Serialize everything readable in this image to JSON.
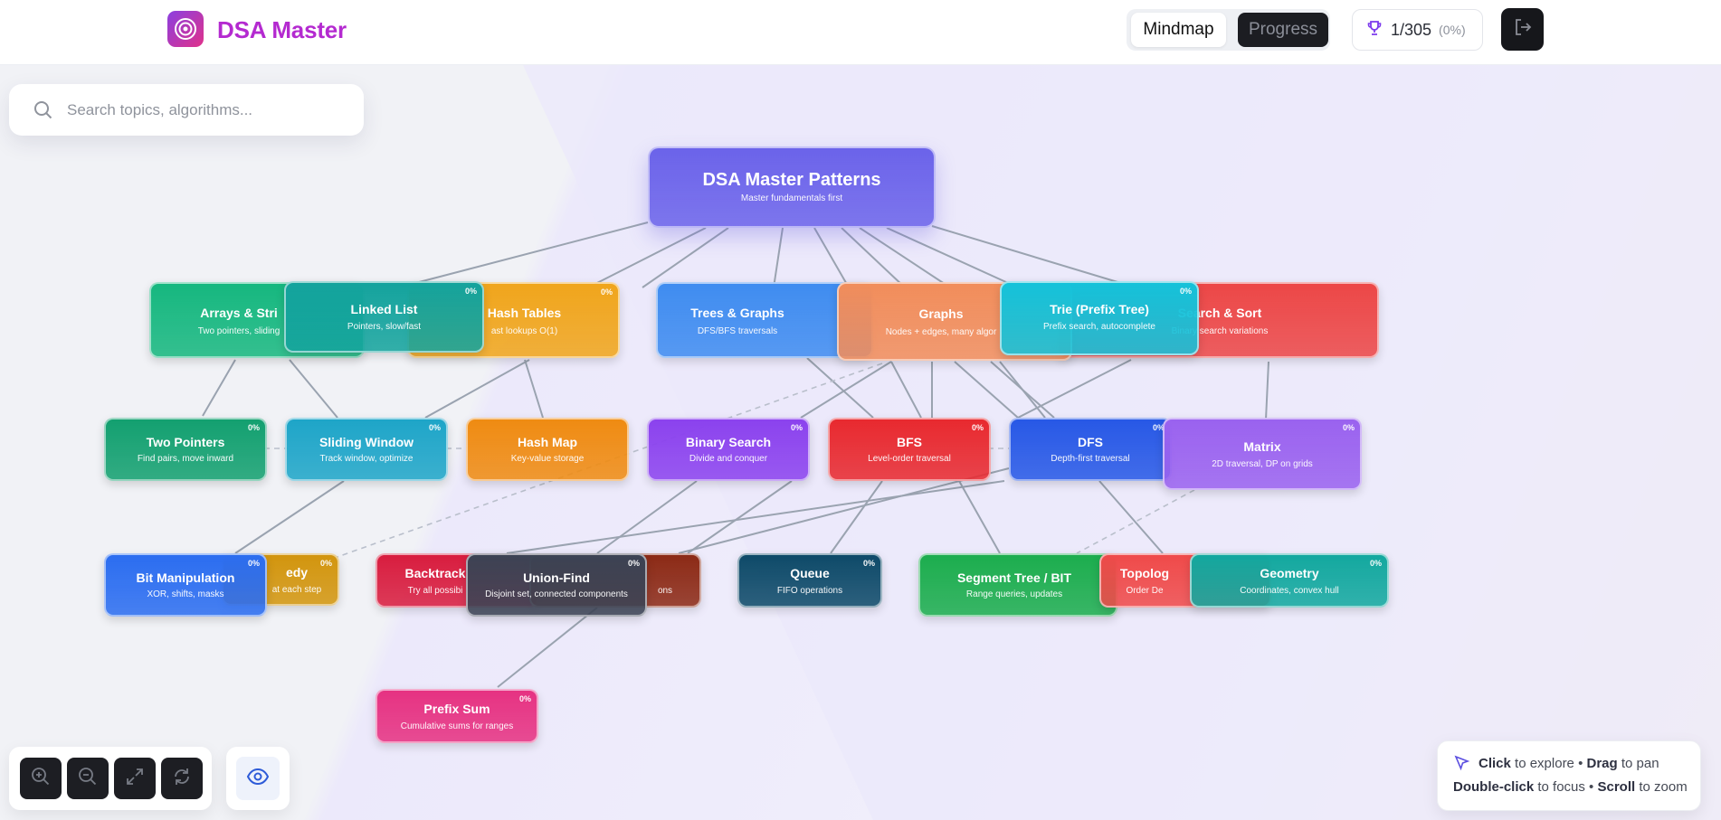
{
  "app": {
    "brand": "DSA Master",
    "logo_icon": "target-icon",
    "view_toggle": {
      "mindmap_label": "Mindmap",
      "progress_label": "Progress",
      "active": "Mindmap"
    },
    "stats": {
      "icon": "trophy-icon",
      "count": "1/305",
      "percent": "(0%)"
    },
    "logout_icon": "logout-icon"
  },
  "search": {
    "placeholder": "Search topics, algorithms...",
    "value": ""
  },
  "nodes": {
    "root": {
      "title": "DSA Master Patterns",
      "subtitle": "Master fundamentals first",
      "color": "#6b63ea"
    },
    "arrays": {
      "title": "Arrays & Stri",
      "subtitle": "Two pointers, sliding",
      "color": "#16b77f"
    },
    "linked_list": {
      "title": "Linked List",
      "subtitle": "Pointers, slow/fast",
      "percent": "0%",
      "color": "#14a39d"
    },
    "hash_tables": {
      "title": "Hash Tables",
      "subtitle": "ast lookups O(1)",
      "percent": "0%",
      "color": "#f0a51c"
    },
    "trees_graphs": {
      "title": "Trees & Graphs",
      "subtitle": "DFS/BFS traversals",
      "color": "#3f8cf0"
    },
    "graphs": {
      "title": "Graphs",
      "subtitle": "Nodes + edges, many algor",
      "color": "#f18d5b"
    },
    "trie": {
      "title": "Trie (Prefix Tree)",
      "subtitle": "Prefix search, autocomplete",
      "percent": "0%",
      "color": "#14c2da"
    },
    "search_sort": {
      "title": "Search & Sort",
      "subtitle": "Binary search variations",
      "color": "#ec4747"
    },
    "two_pointers": {
      "title": "Two Pointers",
      "subtitle": "Find pairs, move inward",
      "percent": "0%",
      "color": "#13a070"
    },
    "sliding_window": {
      "title": "Sliding Window",
      "subtitle": "Track window, optimize",
      "percent": "0%",
      "color": "#1ea5c8"
    },
    "hash_map": {
      "title": "Hash Map",
      "subtitle": "Key-value storage",
      "color": "#ef8b12"
    },
    "binary_search": {
      "title": "Binary Search",
      "subtitle": "Divide and conquer",
      "percent": "0%",
      "color": "#8b42ee"
    },
    "bfs": {
      "title": "BFS",
      "subtitle": "Level-order traversal",
      "percent": "0%",
      "color": "#e8292f"
    },
    "dfs": {
      "title": "DFS",
      "subtitle": "Depth-first traversal",
      "percent": "0%",
      "color": "#2758e6"
    },
    "matrix": {
      "title": "Matrix",
      "subtitle": "2D traversal, DP on grids",
      "percent": "0%",
      "color": "#9a62ef"
    },
    "bit_manipulation": {
      "title": "Bit Manipulation",
      "subtitle": "XOR, shifts, masks",
      "percent": "0%",
      "color": "#2b6df0"
    },
    "greedy": {
      "title": "edy",
      "subtitle": "at each step",
      "percent": "0%",
      "color": "#d2950e"
    },
    "backtracking": {
      "title": "Backtrack",
      "subtitle": "Try all possibi",
      "color": "#d81d3f"
    },
    "union_find_behind": {
      "subtitle": "ons",
      "color": "#8c2a16"
    },
    "union_find": {
      "title": "Union-Find",
      "subtitle": "Disjoint set, connected components",
      "percent": "0%",
      "color": "#3c4354"
    },
    "queue": {
      "title": "Queue",
      "subtitle": "FIFO operations",
      "percent": "0%",
      "color": "#0e4a69"
    },
    "segment_tree": {
      "title": "Segment Tree / BIT",
      "subtitle": "Range queries, updates",
      "color": "#1cad4e"
    },
    "topological": {
      "title": "Topolog",
      "subtitle": "Order De",
      "color": "#ef4a4a"
    },
    "geometry": {
      "title": "Geometry",
      "subtitle": "Coordinates, convex hull",
      "percent": "0%",
      "color": "#13a89f"
    },
    "prefix_sum": {
      "title": "Prefix Sum",
      "subtitle": "Cumulative sums for ranges",
      "percent": "0%",
      "color": "#e63282"
    }
  },
  "zoom_controls": {
    "zoom_in_icon": "zoom-in-icon",
    "zoom_out_icon": "zoom-out-icon",
    "fit_icon": "expand-icon",
    "reset_icon": "refresh-icon",
    "visibility_icon": "eye-icon"
  },
  "help": {
    "line1": {
      "click": "Click",
      "explore": " to explore • ",
      "drag": "Drag",
      "pan": " to pan"
    },
    "line2": {
      "dblclick": "Double-click",
      "focus": " to focus • ",
      "scroll": "Scroll",
      "zoom": " to zoom"
    }
  }
}
